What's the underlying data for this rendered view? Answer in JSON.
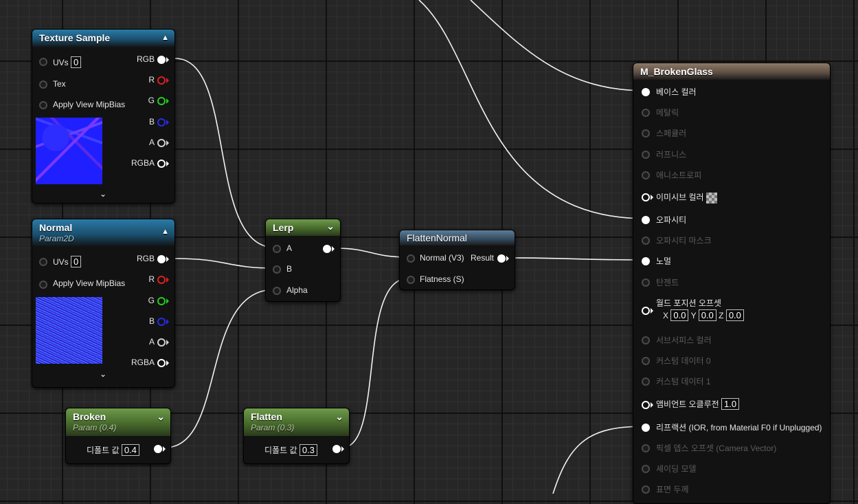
{
  "texture_sample": {
    "title": "Texture Sample",
    "inputs": [
      "UVs",
      "Tex",
      "Apply View MipBias"
    ],
    "uvs_value": "0",
    "outputs": [
      "RGB",
      "R",
      "G",
      "B",
      "A",
      "RGBA"
    ]
  },
  "normal": {
    "title": "Normal",
    "subtitle": "Param2D",
    "inputs": [
      "UVs",
      "Apply View MipBias"
    ],
    "uvs_value": "0",
    "outputs": [
      "RGB",
      "R",
      "G",
      "B",
      "A",
      "RGBA"
    ]
  },
  "lerp": {
    "title": "Lerp",
    "inputs": [
      "A",
      "B",
      "Alpha"
    ]
  },
  "flatten_normal": {
    "title": "FlattenNormal",
    "inputs": [
      "Normal (V3)",
      "Flatness (S)"
    ],
    "output": "Result"
  },
  "broken": {
    "title": "Broken",
    "subtitle": "Param (0.4)",
    "default_label": "디폴트 값",
    "default_value": "0.4"
  },
  "flatten": {
    "title": "Flatten",
    "subtitle": "Param (0.3)",
    "default_label": "디폴트 값",
    "default_value": "0.3"
  },
  "material": {
    "title": "M_BrokenGlass",
    "pins": [
      "베이스 컬러",
      "메탈릭",
      "스페큘러",
      "러프니스",
      "애니소트로피",
      "이미시브 컬러",
      "오파시티",
      "오파시티 마스크",
      "노멀",
      "탄젠트",
      "월드 포지션 오프셋",
      "서브서피스 컬러",
      "커스텀 데이터 0",
      "커스텀 데이터 1",
      "앰비언트 오클루전",
      "리프랙션 (IOR, from Material F0 if Unplugged)",
      "픽셀 뎁스 오프셋 (Camera Vector)",
      "셰이딩 모델",
      "표면 두께"
    ],
    "wpo": {
      "x_label": "X",
      "x": "0.0",
      "y_label": "Y",
      "y": "0.0",
      "z_label": "Z",
      "z": "0.0"
    },
    "ao_value": "1.0"
  },
  "colors": {
    "wire": "#ffffff",
    "node_body": "#121212",
    "blue_header": "#2a7aa6",
    "green_header": "#6e9a4a",
    "material_header": "#8d7a68",
    "pin_red": "#e02020",
    "pin_green": "#22cc22",
    "pin_blue": "#2a2ae8"
  }
}
